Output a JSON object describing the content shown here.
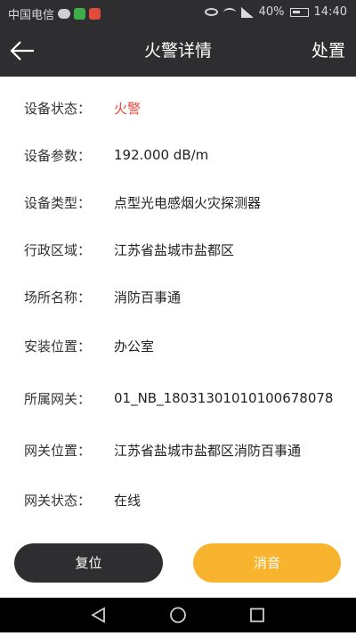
{
  "status_bar": {
    "carrier": "中国电信",
    "battery": "40%",
    "time": "14:40",
    "icons": [
      "chat-bubble-icon",
      "app-green-icon",
      "app-red-icon",
      "eye-icon",
      "wifi-icon",
      "signal-icon",
      "battery-icon"
    ]
  },
  "header": {
    "back_icon": "arrow-left-icon",
    "title": "火警详情",
    "action_label": "处置"
  },
  "details": [
    {
      "label": "设备状态：",
      "value": "火警",
      "highlight": true
    },
    {
      "label": "设备参数：",
      "value": "192.000 dB/m"
    },
    {
      "label": "设备类型：",
      "value": "点型光电感烟火灾探测器"
    },
    {
      "label": "行政区域：",
      "value": "江苏省盐城市盐都区"
    },
    {
      "label": "场所名称：",
      "value": "消防百事通"
    },
    {
      "label": "安装位置：",
      "value": "办公室"
    },
    {
      "label": "所属网关：",
      "value": "01_NB_18031301010100678078"
    },
    {
      "label": "网关位置：",
      "value": "江苏省盐城市盐都区消防百事通"
    },
    {
      "label": "网关状态：",
      "value": "在线"
    }
  ],
  "actions": {
    "reset_label": "复位",
    "mute_label": "消音"
  },
  "colors": {
    "bar_background": "#2e2e30",
    "alarm_text": "#e5463c",
    "mute_button": "#f8b42e"
  },
  "nav_bar": {
    "icons": [
      "back-triangle-icon",
      "home-circle-icon",
      "recent-square-icon"
    ]
  }
}
